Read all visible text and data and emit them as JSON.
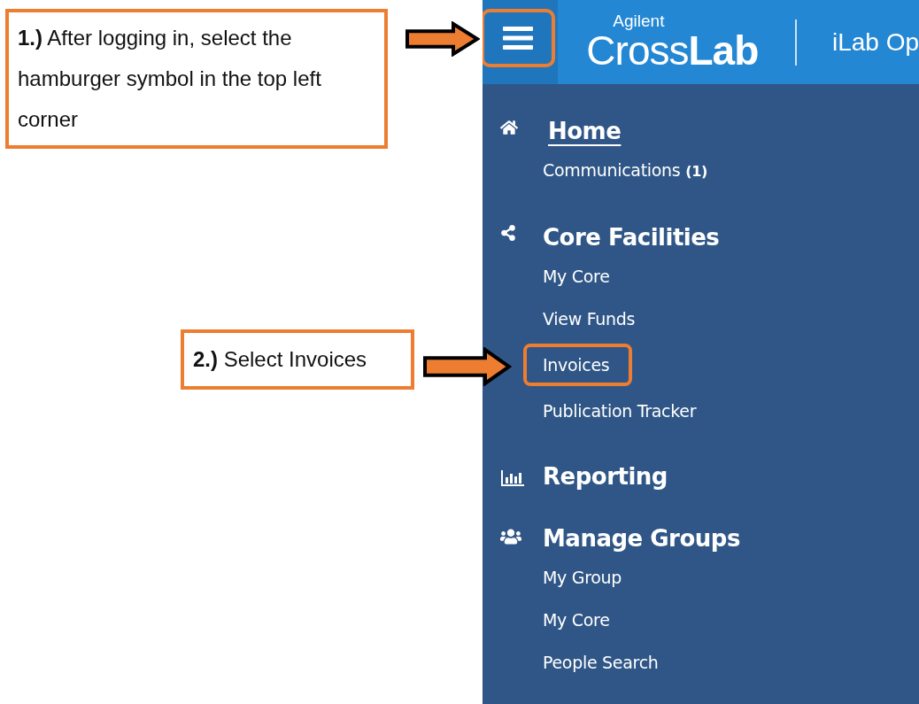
{
  "callouts": [
    {
      "text": "**1.)** After logging in, select the hamburger symbol in the top left corner"
    },
    {
      "text": "**2.)** Select Invoices"
    }
  ],
  "header": {
    "menu_highlighted": true,
    "logo_small": "Agilent",
    "logo_light": "Cross",
    "logo_bold": "Lab",
    "title": "iLab Op"
  },
  "sections": [
    {
      "kind": "home",
      "title": "Home",
      "underlined": true,
      "items": [
        {
          "label": "Communications **(1)**",
          "highlighted": false
        }
      ]
    },
    {
      "kind": "share",
      "title": "Core Facilities",
      "underlined": false,
      "items": [
        {
          "label": "My Core",
          "highlighted": false
        },
        {
          "label": "View Funds",
          "highlighted": false
        },
        {
          "label": "Invoices",
          "highlighted": true
        },
        {
          "label": "Publication Tracker",
          "highlighted": false
        }
      ]
    },
    {
      "kind": "chart",
      "title": "Reporting",
      "underlined": false
    },
    {
      "kind": "users",
      "title": "Manage Groups",
      "underlined": false,
      "items": [
        {
          "label": "My Group",
          "highlighted": false
        },
        {
          "label": "My Core",
          "highlighted": false
        },
        {
          "label": "People Search",
          "highlighted": false
        }
      ]
    }
  ]
}
